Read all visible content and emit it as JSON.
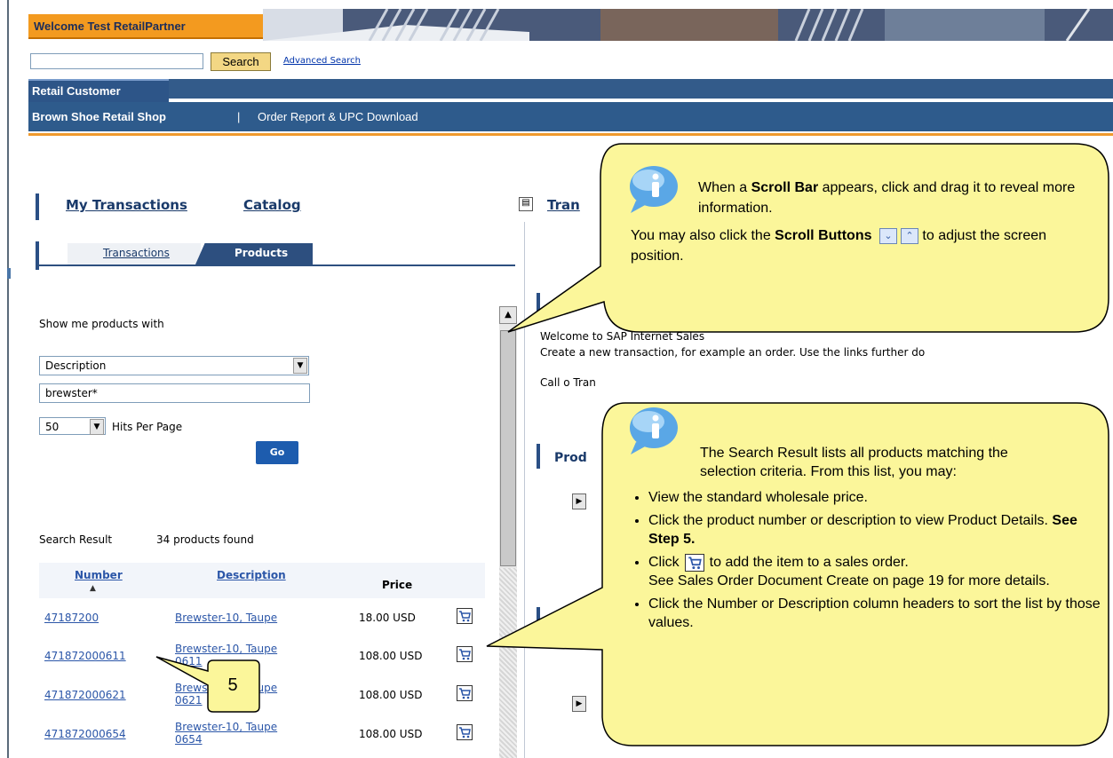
{
  "header": {
    "welcome": "Welcome Test RetailPartner",
    "search_button": "Search",
    "search_value": "",
    "advanced_search": "Advanced Search",
    "tab": "Retail Customer",
    "nav_shop": "Brown Shoe Retail Shop",
    "nav_separator": "|",
    "nav_order_report": "Order Report & UPC Download"
  },
  "left_panel": {
    "my_transactions": "My Transactions",
    "catalog": "Catalog",
    "tab_transactions": "Transactions",
    "tab_products": "Products",
    "show_me": "Show me products with",
    "criteria_selected": "Description",
    "keyword_value": "brewster*",
    "hits_selected": "50",
    "hits_label": "Hits Per Page",
    "go_button": "Go",
    "result_label": "Search Result",
    "result_count": "34 products found",
    "columns": {
      "number": "Number",
      "description": "Description",
      "price": "Price"
    },
    "rows": [
      {
        "number": "47187200",
        "description": "Brewster-10, Taupe",
        "price": "18.00 USD"
      },
      {
        "number": "471872000611",
        "description": "Brewster-10, Taupe 0611",
        "price": "108.00 USD"
      },
      {
        "number": "471872000621",
        "description": "Brewster-10, Taupe 0621",
        "price": "108.00 USD"
      },
      {
        "number": "471872000654",
        "description": "Brewster-10, Taupe 0654",
        "price": "108.00 USD"
      }
    ]
  },
  "right_panel": {
    "transactions_link": "Tran",
    "welcome_line": "Welcome to SAP Internet Sales",
    "create_line": "Create a new transaction, for example an order. Use the links further do",
    "call_line": "Call o Tran",
    "products_head": "Prod"
  },
  "callout_scroll": {
    "line1_prefix": "When a ",
    "line1_bold": "Scroll Bar",
    "line1_suffix": " appears, click and drag it to reveal more information.",
    "line2_prefix": "You may also click the ",
    "line2_bold": "Scroll Buttons",
    "line2_suffix": " to adjust the screen position."
  },
  "callout_results": {
    "intro": "The Search Result lists all products matching the selection criteria.   From this list, you may:",
    "bullet1": "View the standard wholesale price.",
    "bullet2_text": "Click the product number or description to view Product Details.  ",
    "bullet2_bold": "See Step 5",
    "bullet2_end": ".",
    "bullet3_prefix": "Click",
    "bullet3_suffix": "to add the item to a sales order.",
    "bullet3_sub": "See Sales Order Document Create on page 19 for more details.",
    "bullet4": "Click the Number or Description column headers to sort the list by those values."
  },
  "step_label": "5",
  "colors": {
    "callout_fill": "#fbf69a",
    "nav_blue": "#2e5b8c",
    "welcome_orange": "#f39a1f"
  }
}
